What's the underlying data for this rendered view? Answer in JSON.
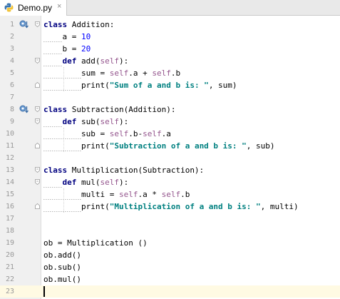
{
  "tab": {
    "filename": "Demo.py",
    "close_glyph": "×",
    "icon": "python-file-icon"
  },
  "lines": [
    {
      "n": "1",
      "tokens": [
        {
          "t": "class ",
          "c": "kw"
        },
        {
          "t": "Addition:",
          "c": ""
        }
      ]
    },
    {
      "n": "2",
      "tokens": [
        {
          "t": "    a = ",
          "c": ""
        },
        {
          "t": "10",
          "c": "num"
        }
      ]
    },
    {
      "n": "3",
      "tokens": [
        {
          "t": "    b = ",
          "c": ""
        },
        {
          "t": "20",
          "c": "num"
        }
      ]
    },
    {
      "n": "4",
      "tokens": [
        {
          "t": "    ",
          "c": ""
        },
        {
          "t": "def ",
          "c": "kw"
        },
        {
          "t": "add(",
          "c": ""
        },
        {
          "t": "self",
          "c": "slf"
        },
        {
          "t": "):",
          "c": ""
        }
      ]
    },
    {
      "n": "5",
      "tokens": [
        {
          "t": "        sum = ",
          "c": ""
        },
        {
          "t": "self",
          "c": "slf"
        },
        {
          "t": ".a + ",
          "c": ""
        },
        {
          "t": "self",
          "c": "slf"
        },
        {
          "t": ".b",
          "c": ""
        }
      ]
    },
    {
      "n": "6",
      "tokens": [
        {
          "t": "        print(",
          "c": ""
        },
        {
          "t": "\"Sum of a and b is: \"",
          "c": "str"
        },
        {
          "t": ", sum)",
          "c": ""
        }
      ]
    },
    {
      "n": "7",
      "tokens": []
    },
    {
      "n": "8",
      "tokens": [
        {
          "t": "class ",
          "c": "kw"
        },
        {
          "t": "Subtraction(Addition):",
          "c": ""
        }
      ]
    },
    {
      "n": "9",
      "tokens": [
        {
          "t": "    ",
          "c": ""
        },
        {
          "t": "def ",
          "c": "kw"
        },
        {
          "t": "sub(",
          "c": ""
        },
        {
          "t": "self",
          "c": "slf"
        },
        {
          "t": "):",
          "c": ""
        }
      ]
    },
    {
      "n": "10",
      "tokens": [
        {
          "t": "        sub = ",
          "c": ""
        },
        {
          "t": "self",
          "c": "slf"
        },
        {
          "t": ".b-",
          "c": ""
        },
        {
          "t": "self",
          "c": "slf"
        },
        {
          "t": ".a",
          "c": ""
        }
      ]
    },
    {
      "n": "11",
      "tokens": [
        {
          "t": "        print(",
          "c": ""
        },
        {
          "t": "\"Subtraction of a and b is: \"",
          "c": "str"
        },
        {
          "t": ", sub)",
          "c": ""
        }
      ]
    },
    {
      "n": "12",
      "tokens": []
    },
    {
      "n": "13",
      "tokens": [
        {
          "t": "class ",
          "c": "kw"
        },
        {
          "t": "Multiplication(Subtraction):",
          "c": ""
        }
      ]
    },
    {
      "n": "14",
      "tokens": [
        {
          "t": "    ",
          "c": ""
        },
        {
          "t": "def ",
          "c": "kw"
        },
        {
          "t": "mul(",
          "c": ""
        },
        {
          "t": "self",
          "c": "slf"
        },
        {
          "t": "):",
          "c": ""
        }
      ]
    },
    {
      "n": "15",
      "tokens": [
        {
          "t": "        multi = ",
          "c": ""
        },
        {
          "t": "self",
          "c": "slf"
        },
        {
          "t": ".a * ",
          "c": ""
        },
        {
          "t": "self",
          "c": "slf"
        },
        {
          "t": ".b",
          "c": ""
        }
      ]
    },
    {
      "n": "16",
      "tokens": [
        {
          "t": "        print(",
          "c": ""
        },
        {
          "t": "\"Multiplication of a and b is: \"",
          "c": "str"
        },
        {
          "t": ", multi)",
          "c": ""
        }
      ]
    },
    {
      "n": "17",
      "tokens": []
    },
    {
      "n": "18",
      "tokens": []
    },
    {
      "n": "19",
      "tokens": [
        {
          "t": "ob = Multiplication ()",
          "c": ""
        }
      ]
    },
    {
      "n": "20",
      "tokens": [
        {
          "t": "ob.add()",
          "c": ""
        }
      ]
    },
    {
      "n": "21",
      "tokens": [
        {
          "t": "ob.sub()",
          "c": ""
        }
      ]
    },
    {
      "n": "22",
      "tokens": [
        {
          "t": "ob.mul()",
          "c": ""
        }
      ]
    },
    {
      "n": "23",
      "tokens": []
    }
  ],
  "current_line": "23",
  "colors": {
    "keyword": "#000080",
    "self": "#94558d",
    "number": "#0000ff",
    "string": "#008080",
    "current_line_bg": "#fffae3"
  }
}
